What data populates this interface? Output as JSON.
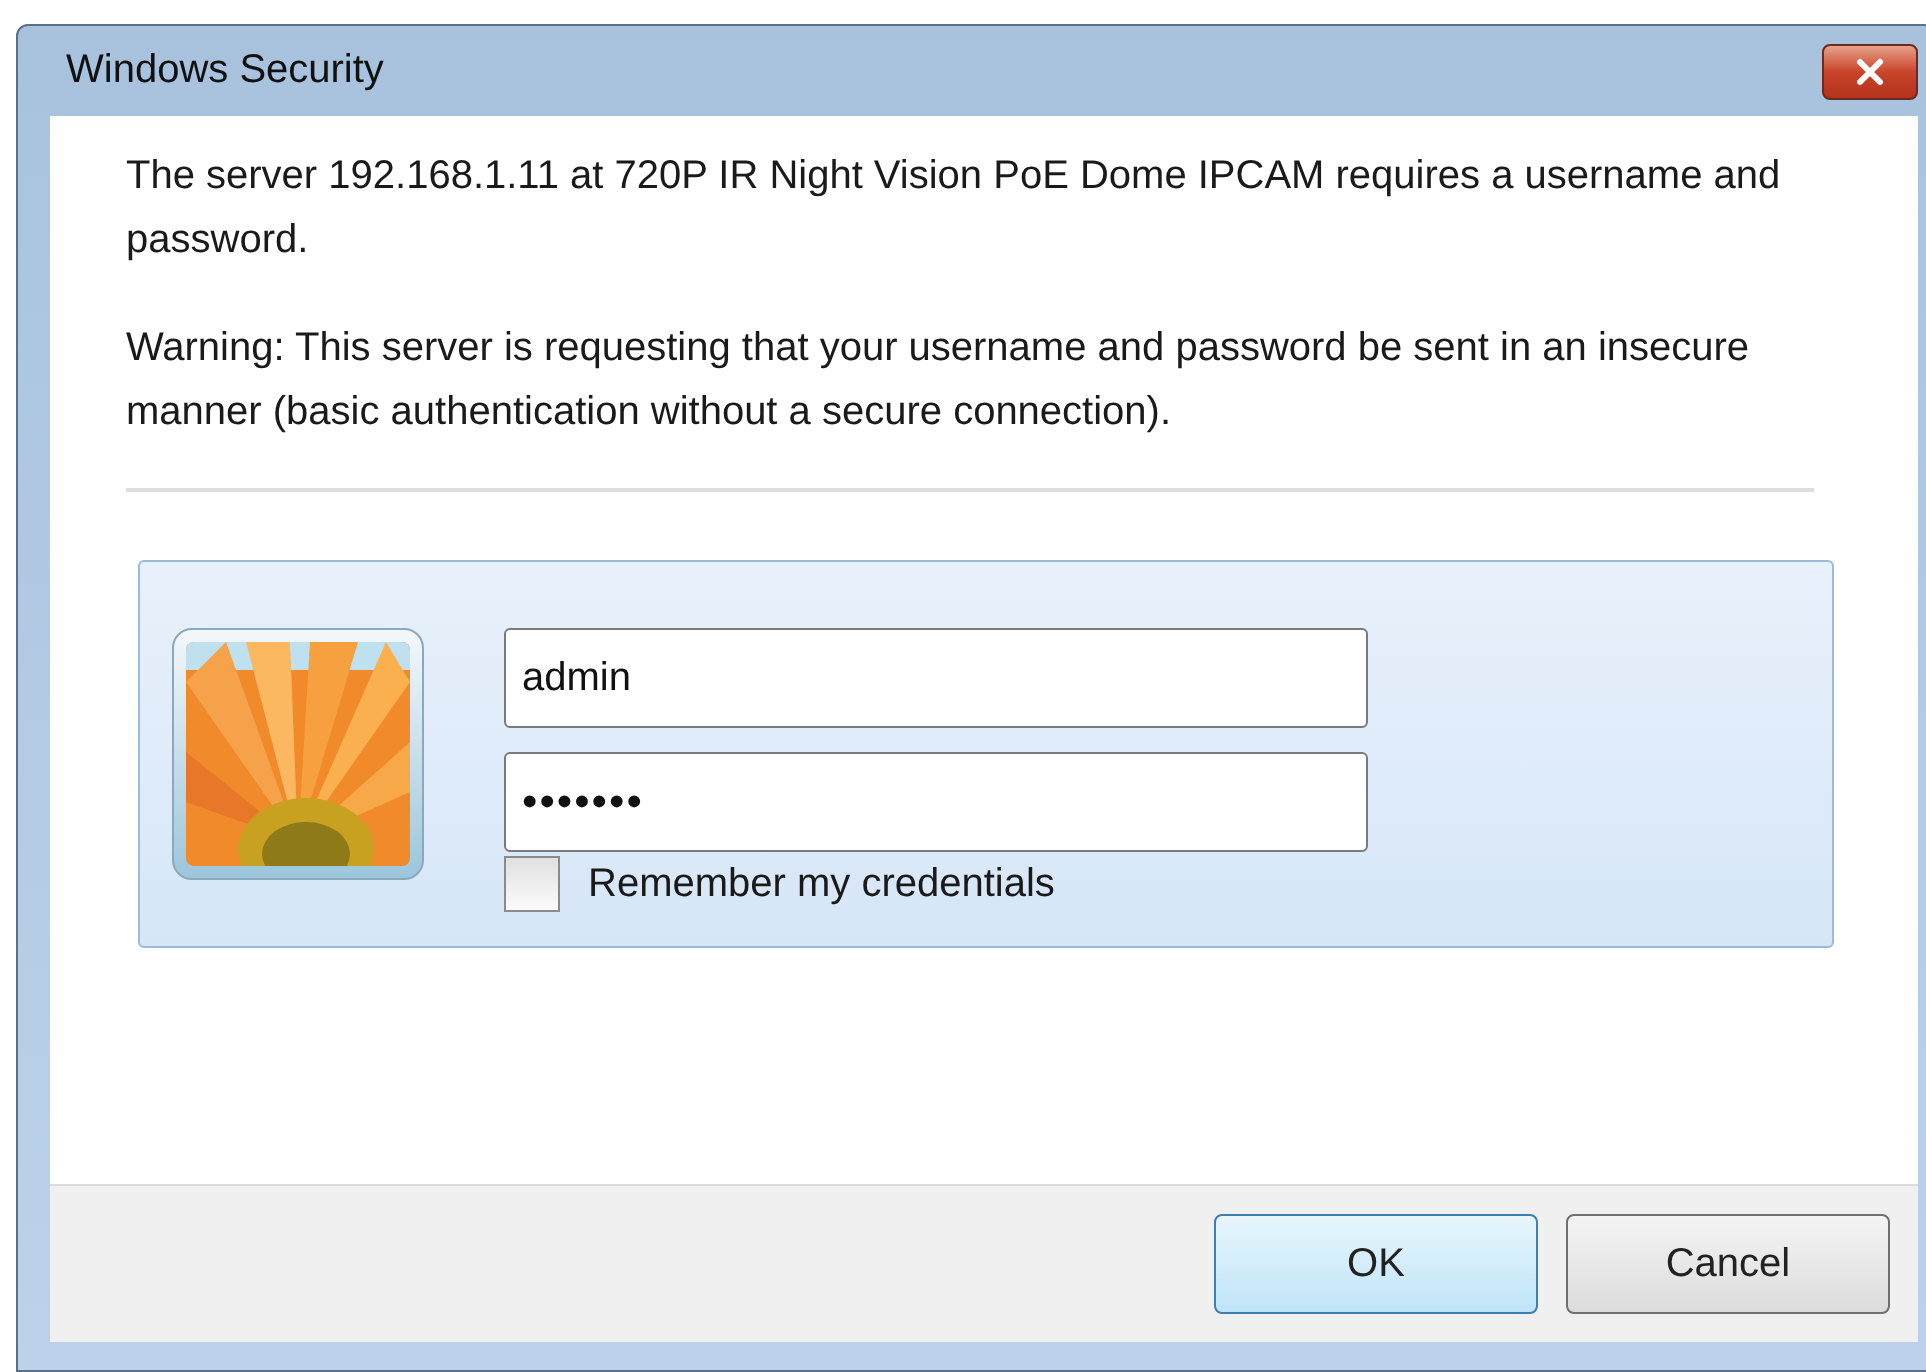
{
  "window": {
    "title": "Windows Security"
  },
  "message": "The server 192.168.1.11 at 720P IR Night Vision PoE Dome IPCAM requires a username and password.",
  "warning": "Warning: This server is requesting that your username and password be sent in an insecure manner (basic authentication without a secure connection).",
  "credentials": {
    "username": "admin",
    "password": "•••••••",
    "remember": {
      "label": "Remember my credentials",
      "checked": false
    }
  },
  "buttons": [
    {
      "label": "OK",
      "default": true
    },
    {
      "label": "Cancel",
      "default": false
    }
  ]
}
